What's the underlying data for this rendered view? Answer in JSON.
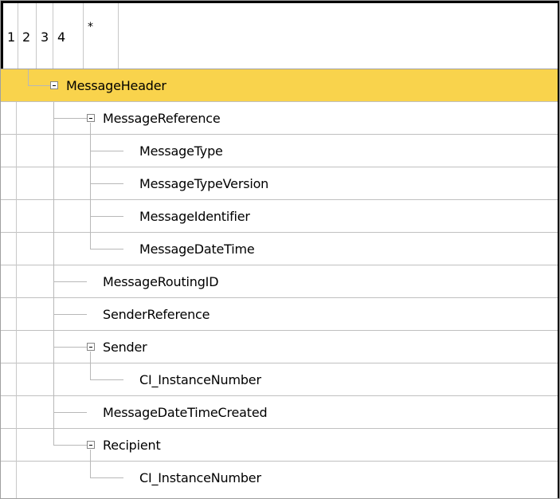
{
  "header": {
    "level_buttons": [
      {
        "label": "1"
      },
      {
        "label": "2"
      },
      {
        "label": "3"
      },
      {
        "label": "4"
      },
      {
        "label": "*"
      }
    ]
  },
  "tree": {
    "selection_color": "#f9d34c",
    "rows": [
      {
        "label": "MessageHeader",
        "level": 1,
        "expandable": true,
        "selected": true
      },
      {
        "label": "MessageReference",
        "level": 2,
        "expandable": true
      },
      {
        "label": "MessageType",
        "level": 3
      },
      {
        "label": "MessageTypeVersion",
        "level": 3
      },
      {
        "label": "MessageIdentifier",
        "level": 3
      },
      {
        "label": "MessageDateTime",
        "level": 3
      },
      {
        "label": "MessageRoutingID",
        "level": 2
      },
      {
        "label": "SenderReference",
        "level": 2
      },
      {
        "label": "Sender",
        "level": 2,
        "expandable": true
      },
      {
        "label": "CI_InstanceNumber",
        "level": 3
      },
      {
        "label": "MessageDateTimeCreated",
        "level": 2
      },
      {
        "label": "Recipient",
        "level": 2,
        "expandable": true
      },
      {
        "label": "CI_InstanceNumber",
        "level": 3
      }
    ]
  }
}
